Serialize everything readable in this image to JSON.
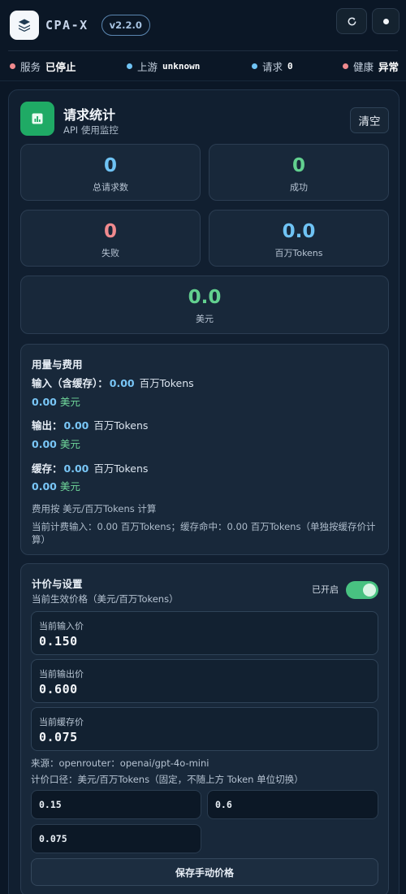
{
  "header": {
    "app_title": "CPA-X",
    "version": "v2.2.0",
    "icons": {
      "logo": "layers-icon",
      "refresh": "refresh-icon",
      "theme": "dot-icon"
    }
  },
  "status": {
    "service": {
      "label": "服务",
      "value": "已停止",
      "color": "#f08a8e"
    },
    "upstream": {
      "label": "上游",
      "value": "unknown",
      "color": "#6fc3f4"
    },
    "requests": {
      "label": "请求",
      "value": "0",
      "color": "#6fc3f4"
    },
    "health": {
      "label": "健康",
      "value": "异常",
      "color": "#f08a8e"
    }
  },
  "stats_panel": {
    "title": "请求统计",
    "subtitle": "API 使用监控",
    "clear_label": "清空",
    "icon": "bar-chart-icon",
    "cards": {
      "total": {
        "value": "0",
        "label": "总请求数"
      },
      "success": {
        "value": "0",
        "label": "成功"
      },
      "failed": {
        "value": "0",
        "label": "失败"
      },
      "mtokens": {
        "value": "0.0",
        "label": "百万Tokens"
      },
      "usd": {
        "value": "0.0",
        "label": "美元"
      }
    }
  },
  "usage": {
    "title": "用量与费用",
    "input": {
      "label": "输入（含缓存）：",
      "tokens": "0.00",
      "token_unit": "百万Tokens",
      "cost": "0.00",
      "cost_unit": "美元"
    },
    "output": {
      "label": "输出：",
      "tokens": "0.00",
      "token_unit": "百万Tokens",
      "cost": "0.00",
      "cost_unit": "美元"
    },
    "cache": {
      "label": "缓存：",
      "tokens": "0.00",
      "token_unit": "百万Tokens",
      "cost": "0.00",
      "cost_unit": "美元"
    },
    "note1": "费用按 美元/百万Tokens 计算",
    "note2": "当前计费输入：0.00 百万Tokens；缓存命中：0.00 百万Tokens（单独按缓存价计算）"
  },
  "settings": {
    "title": "计价与设置",
    "subtitle": "当前生效价格（美元/百万Tokens）",
    "toggle_label": "已开启",
    "toggle_on": true,
    "prices": {
      "input": {
        "label": "当前输入价",
        "value": "0.150"
      },
      "output": {
        "label": "当前输出价",
        "value": "0.600"
      },
      "cache": {
        "label": "当前缓存价",
        "value": "0.075"
      }
    },
    "source": "来源：openrouter：openai/gpt-4o-mini",
    "caliber": "计价口径：美元/百万Tokens（固定，不随上方 Token 单位切换）",
    "inputs": {
      "input_price": "0.15",
      "output_price": "0.6",
      "cache_price": "0.075"
    },
    "save_label": "保存手动价格"
  }
}
